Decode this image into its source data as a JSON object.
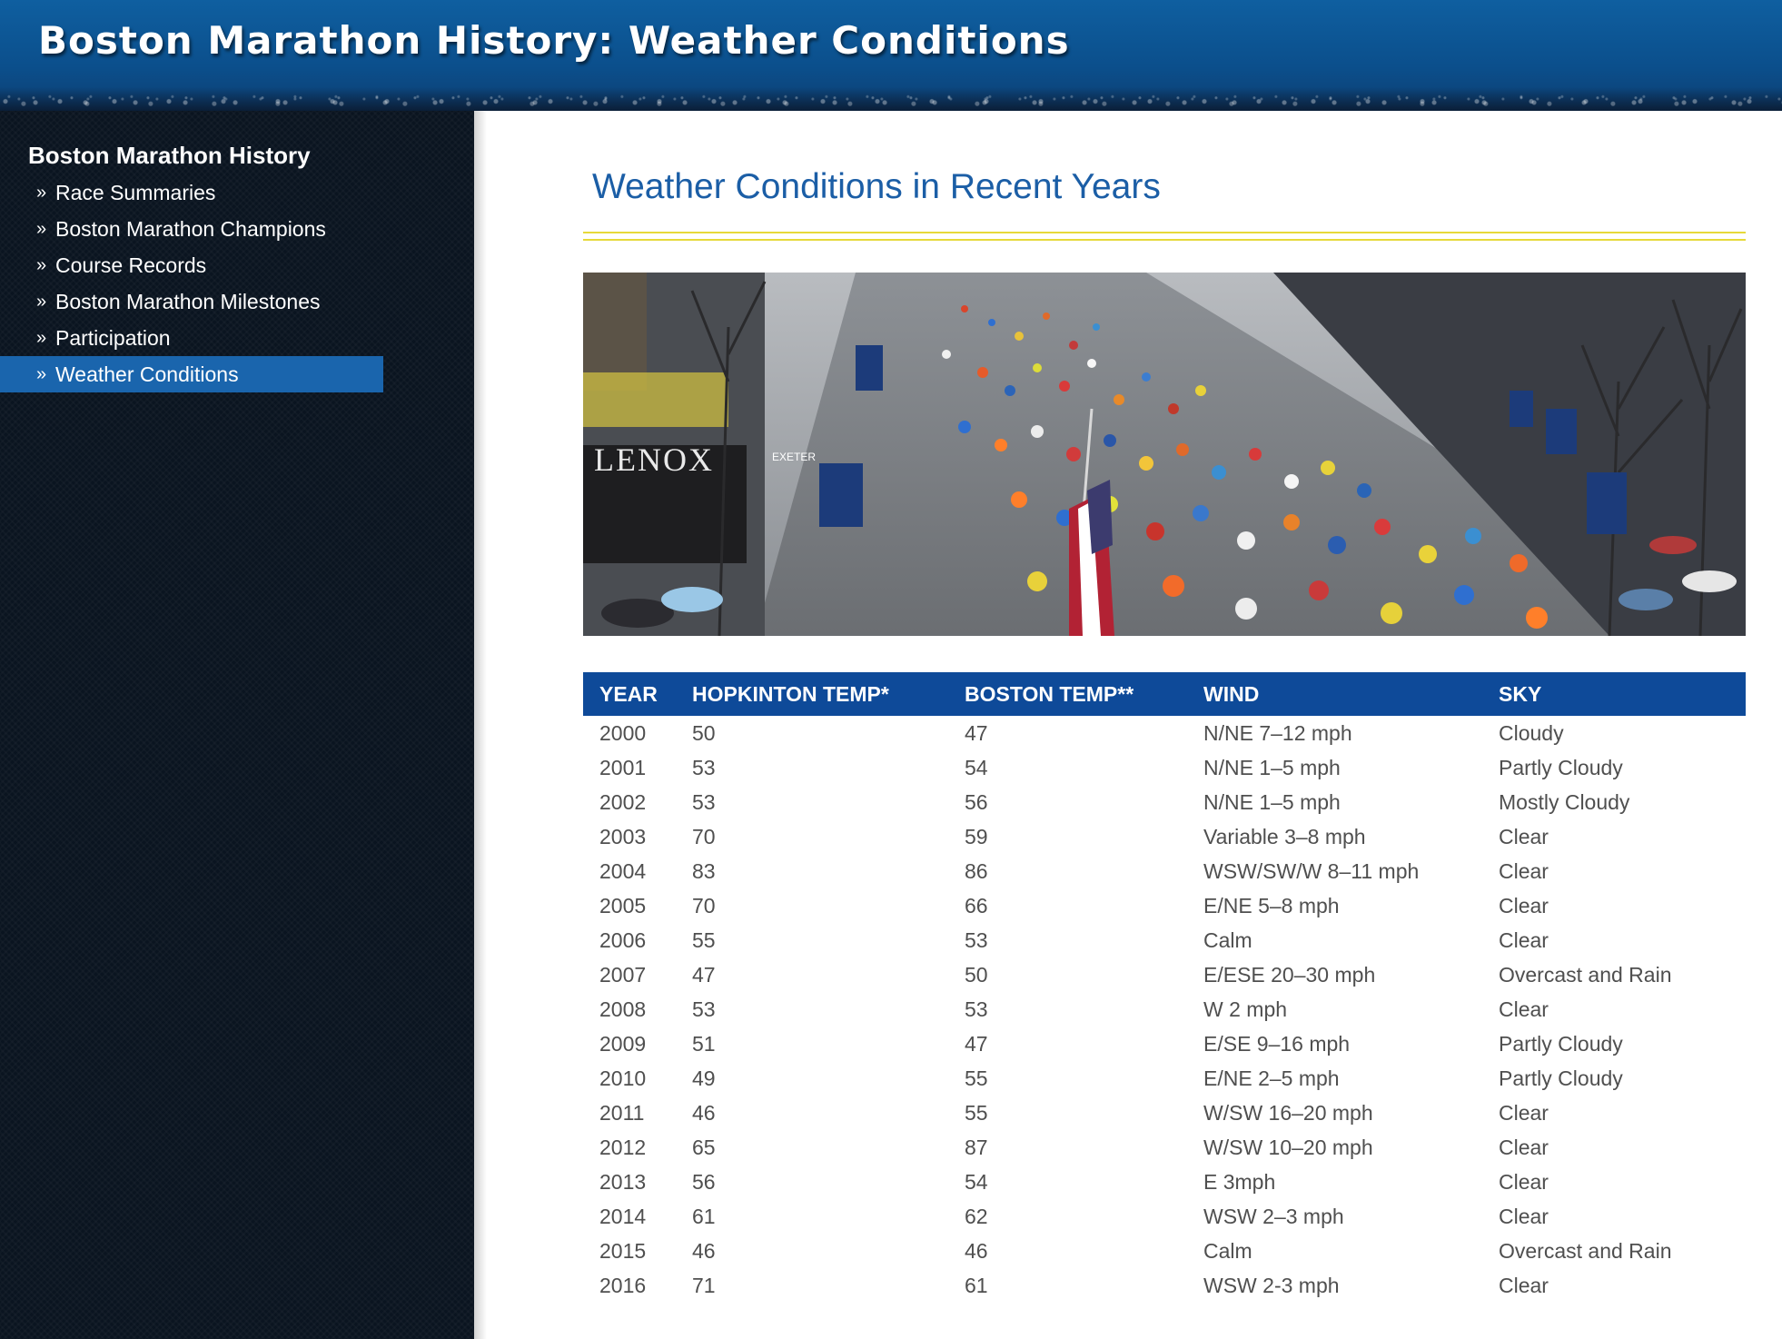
{
  "header": {
    "title": "Boston Marathon History: Weather Conditions"
  },
  "sidebar": {
    "heading": "Boston Marathon History",
    "items": [
      {
        "label": "Race Summaries",
        "active": false
      },
      {
        "label": "Boston Marathon Champions",
        "active": false
      },
      {
        "label": "Course Records",
        "active": false
      },
      {
        "label": "Boston Marathon Milestones",
        "active": false
      },
      {
        "label": "Participation",
        "active": false
      },
      {
        "label": "Weather Conditions",
        "active": true
      }
    ]
  },
  "main": {
    "title": "Weather Conditions in Recent Years",
    "photo": {
      "storefront_text": "LENOX",
      "street_sign": "EXETER"
    },
    "table": {
      "columns": [
        "YEAR",
        "HOPKINTON TEMP*",
        "BOSTON TEMP**",
        "WIND",
        "SKY"
      ],
      "rows": [
        [
          "2000",
          "50",
          "47",
          "N/NE 7–12 mph",
          "Cloudy"
        ],
        [
          "2001",
          "53",
          "54",
          "N/NE 1–5 mph",
          "Partly Cloudy"
        ],
        [
          "2002",
          "53",
          "56",
          "N/NE 1–5 mph",
          "Mostly Cloudy"
        ],
        [
          "2003",
          "70",
          "59",
          "Variable 3–8 mph",
          "Clear"
        ],
        [
          "2004",
          "83",
          "86",
          "WSW/SW/W 8–11 mph",
          "Clear"
        ],
        [
          "2005",
          "70",
          "66",
          "E/NE 5–8 mph",
          "Clear"
        ],
        [
          "2006",
          "55",
          "53",
          "Calm",
          "Clear"
        ],
        [
          "2007",
          "47",
          "50",
          "E/ESE 20–30 mph",
          "Overcast and Rain"
        ],
        [
          "2008",
          "53",
          "53",
          "W 2 mph",
          "Clear"
        ],
        [
          "2009",
          "51",
          "47",
          "E/SE 9–16 mph",
          "Partly Cloudy"
        ],
        [
          "2010",
          "49",
          "55",
          "E/NE 2–5 mph",
          "Partly Cloudy"
        ],
        [
          "2011",
          "46",
          "55",
          "W/SW 16–20 mph",
          "Clear"
        ],
        [
          "2012",
          "65",
          "87",
          "W/SW 10–20 mph",
          "Clear"
        ],
        [
          "2013",
          "56",
          "54",
          "E 3mph",
          "Clear"
        ],
        [
          "2014",
          "61",
          "62",
          "WSW 2–3 mph",
          "Clear"
        ],
        [
          "2015",
          "46",
          "46",
          "Calm",
          "Overcast and Rain"
        ],
        [
          "2016",
          "71",
          "61",
          "WSW 2-3 mph",
          "Clear"
        ]
      ]
    }
  },
  "colors": {
    "header_blue": "#0b4f8c",
    "sidebar_bg": "#0a1420",
    "active_item": "#1a65ad",
    "title_blue": "#1b5ea6",
    "rule_yellow": "#e6d93a",
    "table_header": "#0e4a99",
    "cell_text": "#4f4f4f"
  },
  "icons": {
    "nav_bullet": "double-chevron-right-icon"
  }
}
